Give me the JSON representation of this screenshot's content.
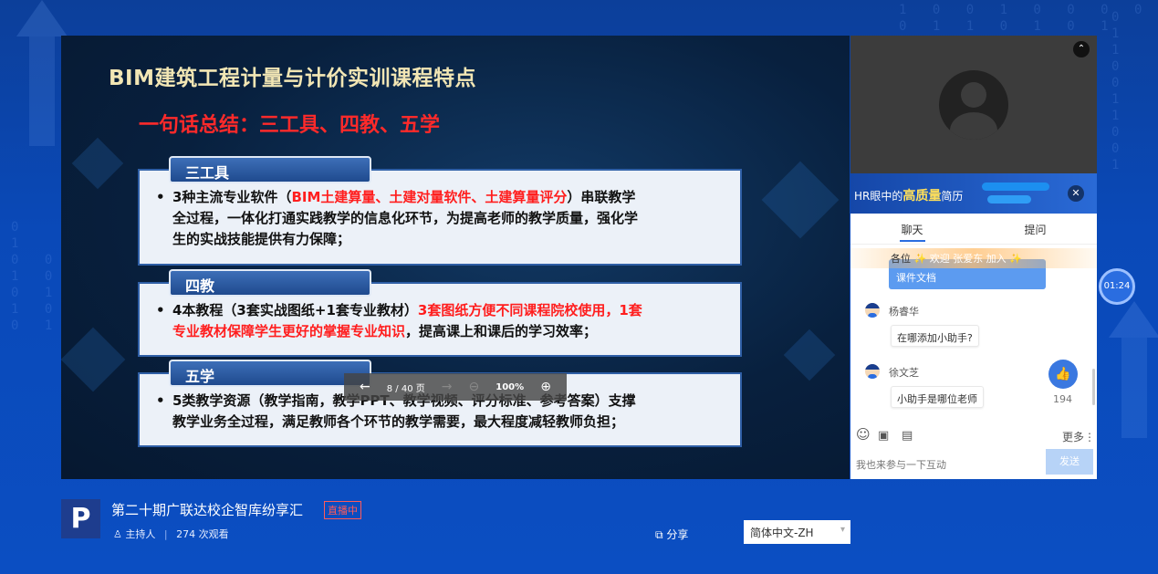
{
  "slide": {
    "title": "BIM建筑工程计量与计价实训课程特点",
    "summary": "一句话总结：三工具、四教、五学",
    "sections": [
      {
        "tab": "三工具",
        "bullet": "•",
        "line1_a": "3种主流专业软件（",
        "line1_red": "BIM土建算量、土建对量软件、土建算量评分",
        "line1_b": "）串联教学",
        "line2": "全过程，一体化打通实践教学的信息化环节，为提高老师的教学质量，强化学",
        "line3": "生的实战技能提供有力保障；"
      },
      {
        "tab": "四教",
        "bullet": "•",
        "line1_a": "4本教程（3套实战图纸+1套专业教材）",
        "line1_red": "3套图纸方便不同课程院校使用，1套",
        "line2_red": "专业教材保障学生更好的掌握专业知识",
        "line2_b": "，提高课上和课后的学习效率；"
      },
      {
        "tab": "五学",
        "bullet": "•",
        "line1": "5类教学资源（教学指南，教学PPT、教学视频、评分标准、参考答案）支撑",
        "line2": "教学业务全过程，满足教师各个环节的教学需要，最大程度减轻教师负担；"
      }
    ]
  },
  "page_control": {
    "prev": "←",
    "page": "8 / 40 页",
    "next": "→",
    "zoom_out": "⊖",
    "zoom": "100%",
    "zoom_in": "⊕"
  },
  "video": {
    "collapse": "⌃"
  },
  "banner": {
    "text_a": "HR眼中的",
    "text_b": "高质量",
    "text_c": "简历",
    "close": "✕"
  },
  "chat": {
    "tabs": [
      "聊天",
      "提问"
    ],
    "welcome": "✨ 欢迎 张爱东 加入 ✨",
    "welcome_prefix": "各位",
    "doc_message": "课件文档",
    "messages": [
      {
        "name": "杨睿华",
        "text": "在哪添加小助手?"
      },
      {
        "name": "徐文芝",
        "text": "小助手是哪位老师"
      }
    ],
    "like_icon": "👍",
    "like_count": "194",
    "more": "更多⋮",
    "emoji": "☺",
    "image": "▣",
    "file": "▤",
    "input_placeholder": "我也来参与一下互动",
    "send": "发送"
  },
  "timer": "01:24",
  "footer": {
    "logo": "P",
    "title": "第二十期广联达校企智库纷享汇",
    "live": "直播中",
    "host_icon": "♙",
    "host": "主持人",
    "separator": "|",
    "views": "274 次观看",
    "share_icon": "⧉",
    "share": "分享",
    "language": "简体中文-ZH",
    "language_caret": "▾"
  }
}
